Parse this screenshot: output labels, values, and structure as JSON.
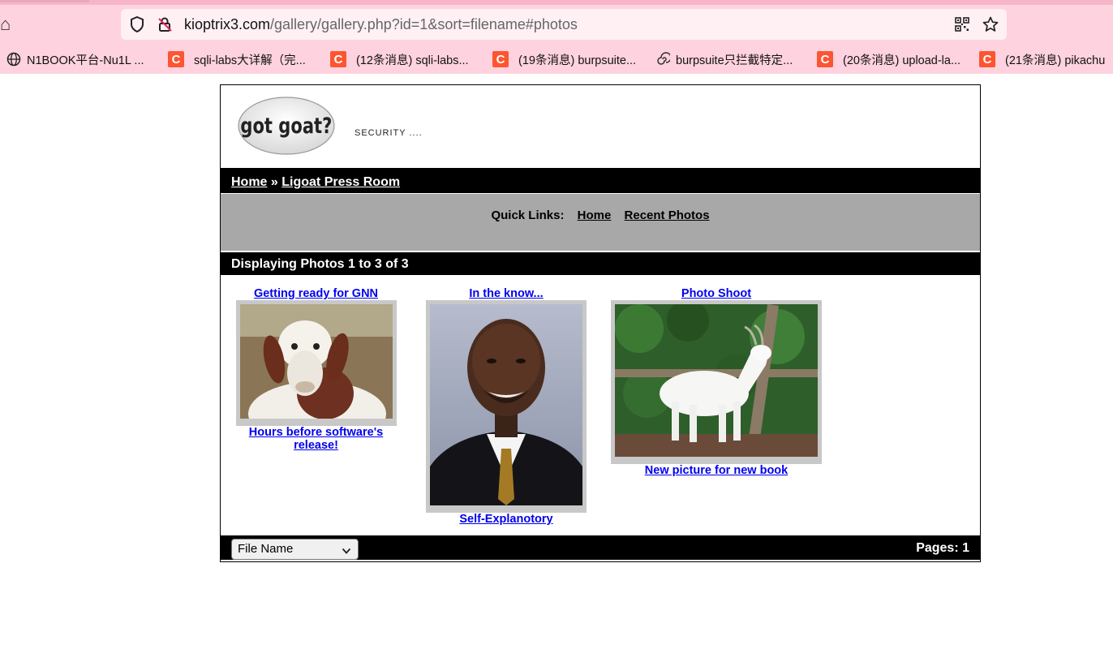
{
  "browser": {
    "url_host": "kioptrix3.com",
    "url_path": "/gallery/gallery.php?id=1&sort=filename#photos",
    "bookmarks": [
      {
        "icon": "globe-icon",
        "label": "N1BOOK平台-Nu1L ..."
      },
      {
        "icon": "csdn-icon",
        "label": "sqli-labs大详解（完..."
      },
      {
        "icon": "csdn-icon",
        "label": "(12条消息) sqli-labs..."
      },
      {
        "icon": "csdn-icon",
        "label": "(19条消息) burpsuite..."
      },
      {
        "icon": "spiral-icon",
        "label": "burpsuite只拦截特定..."
      },
      {
        "icon": "csdn-icon",
        "label": "(20条消息) upload-la..."
      },
      {
        "icon": "csdn-icon",
        "label": "(21条消息) pikachu"
      }
    ]
  },
  "site": {
    "logo_text": "got goat?",
    "tagline": "SECURITY ....",
    "breadcrumb": {
      "home": "Home",
      "separator": "»",
      "current": "Ligoat Press Room"
    },
    "quick_links": {
      "label": "Quick Links:",
      "home": "Home",
      "recent": "Recent Photos"
    },
    "display_text": "Displaying Photos 1 to 3 of 3",
    "photos": [
      {
        "title": "Getting ready for GNN",
        "caption_line1": "Hours before software's",
        "caption_line2": "release!",
        "image": "brown-and-white-goat-photo"
      },
      {
        "title": "In the know...",
        "caption_line1": "Self-Explanotory",
        "caption_line2": "",
        "image": "portrait-man-in-suit-photo"
      },
      {
        "title": "Photo Shoot",
        "caption_line1": "New picture for new book",
        "caption_line2": "",
        "image": "white-goat-on-fence-photo"
      }
    ],
    "sort": {
      "selected": "File Name"
    },
    "pages": "Pages: 1"
  }
}
